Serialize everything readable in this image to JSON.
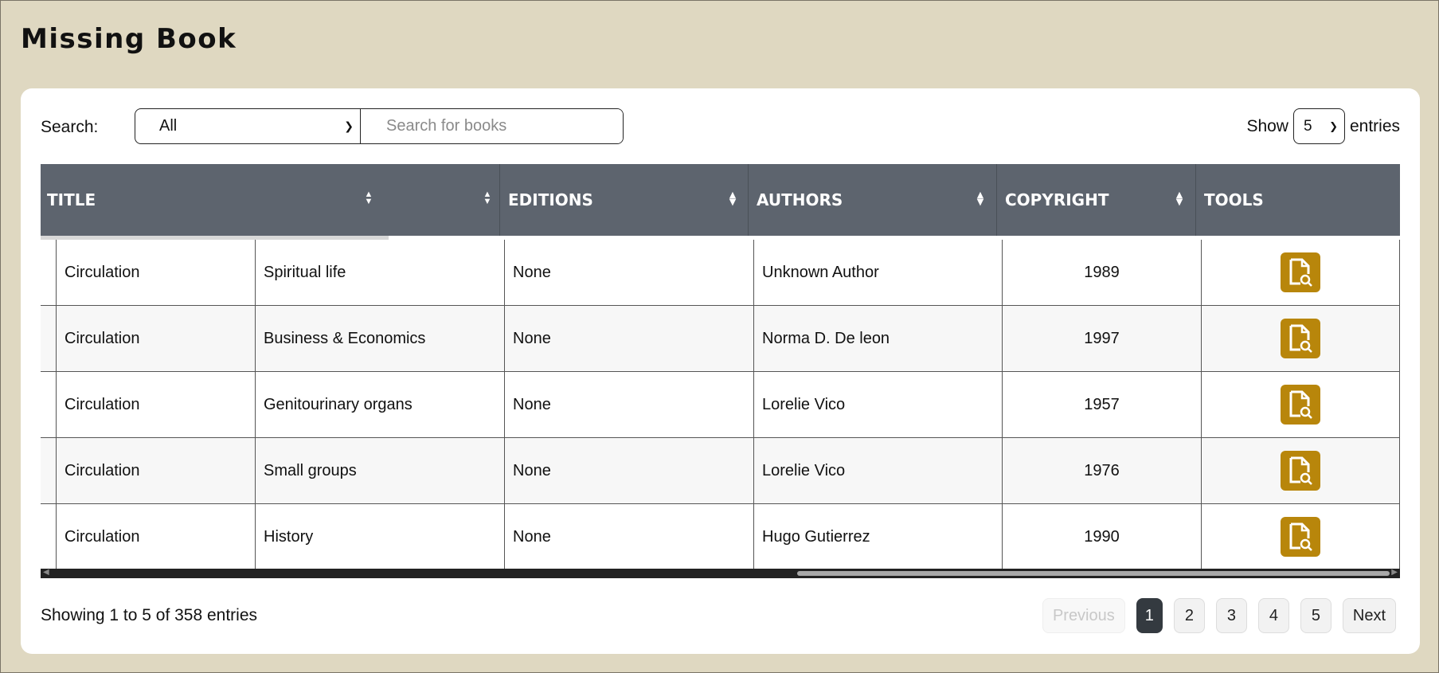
{
  "page": {
    "title": "Missing Book"
  },
  "controls": {
    "search_label": "Search:",
    "filter_value": "All",
    "search_placeholder": "Search for books",
    "show_label": "Show",
    "page_length": "5",
    "entries_label": "entries"
  },
  "table": {
    "columns": [
      "TITLE",
      "EDITIONS",
      "AUTHORS",
      "COPYRIGHT",
      "TOOLS"
    ],
    "rows": [
      {
        "section": "Circulation",
        "title": "Spiritual life",
        "editions": "None",
        "authors": "Unknown Author",
        "copyright": "1989"
      },
      {
        "section": "Circulation",
        "title": "Business & Economics",
        "editions": "None",
        "authors": "Norma D. De leon",
        "copyright": "1997"
      },
      {
        "section": "Circulation",
        "title": "Genitourinary organs",
        "editions": "None",
        "authors": "Lorelie Vico",
        "copyright": "1957"
      },
      {
        "section": "Circulation",
        "title": "Small groups",
        "editions": "None",
        "authors": "Lorelie Vico",
        "copyright": "1976"
      },
      {
        "section": "Circulation",
        "title": "History",
        "editions": "None",
        "authors": "Hugo Gutierrez",
        "copyright": "1990"
      }
    ]
  },
  "footer": {
    "info": "Showing 1 to 5 of 358 entries",
    "previous": "Previous",
    "pages": [
      "1",
      "2",
      "3",
      "4",
      "5"
    ],
    "next": "Next",
    "current_page": "1"
  },
  "colors": {
    "background": "#dfd8c1",
    "header": "#5d646e",
    "accent": "#b8860b",
    "active_page": "#343a40"
  },
  "icons": {
    "sort": "sort-icon",
    "view": "file-search-icon",
    "dropdown": "chevron-down-icon"
  }
}
